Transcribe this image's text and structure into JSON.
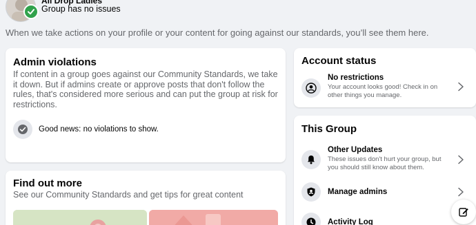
{
  "header": {
    "group_name": "All Drop Ladies",
    "group_status": "Group has no issues"
  },
  "intro_text": "When we take actions on your profile or your content for going against our standards, you’ll see them here.",
  "admin_violations": {
    "title": "Admin violations",
    "description": "If content in a group goes against our Community Standards, we take it down. But if admins create or approve posts that don't follow the rules, that's considered more serious and can put the group at risk for restrictions.",
    "good_news": "Good news: no violations to show."
  },
  "find_out_more": {
    "title": "Find out more",
    "subtitle": "See our Community Standards and get tips for great content"
  },
  "account_status": {
    "title": "Account status",
    "item_title": "No restrictions",
    "item_sub": "Your account looks good! Check in on other things you manage."
  },
  "this_group": {
    "title": "This Group",
    "items": [
      {
        "label": "Other Updates",
        "sub": "These issues don't hurt your group, but you should still know about them."
      },
      {
        "label": "Manage admins",
        "sub": ""
      },
      {
        "label": "Activity Log",
        "sub": ""
      }
    ]
  },
  "colors": {
    "page_bg": "#f0f2f5",
    "card_bg": "#ffffff",
    "badge_green": "#31a24c",
    "muted_text": "#65676b"
  }
}
